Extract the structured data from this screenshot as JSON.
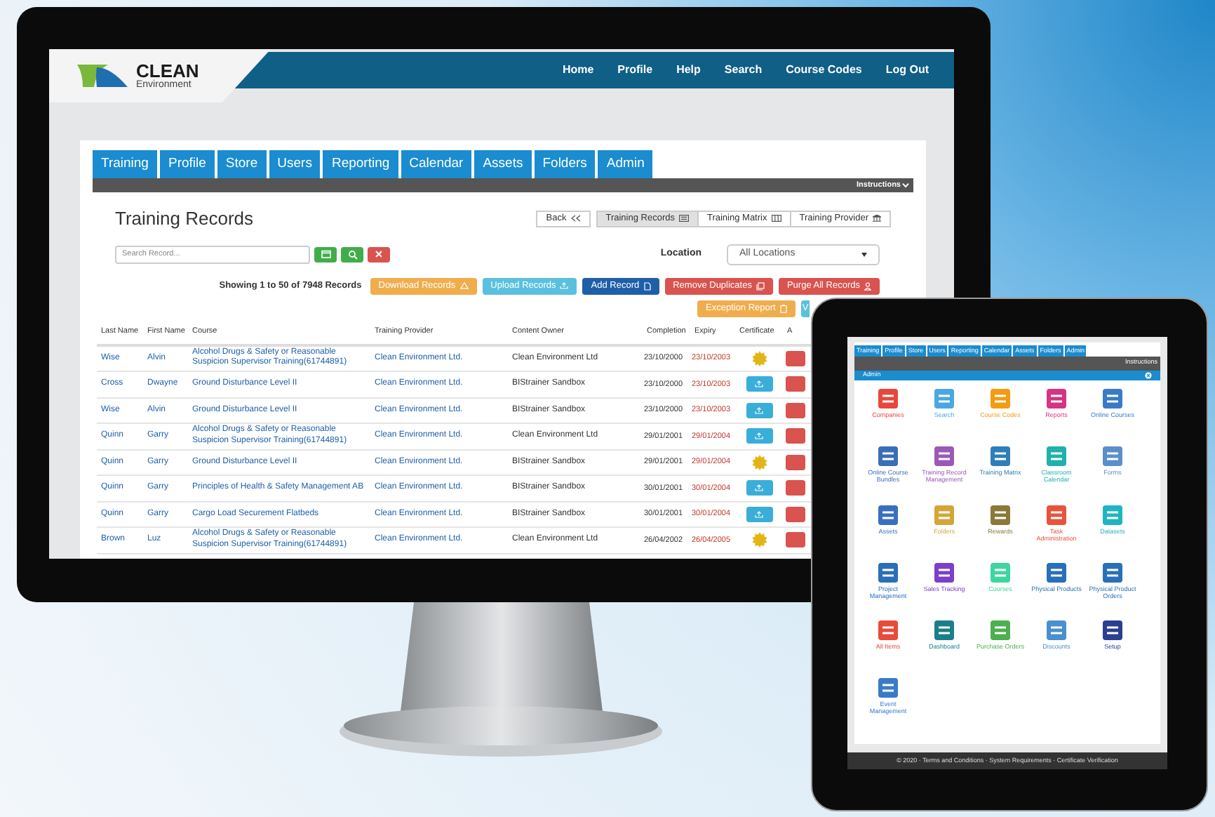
{
  "header": {
    "logo": {
      "title": "CLEAN",
      "subtitle": "Environment"
    },
    "nav": [
      "Home",
      "Profile",
      "Help",
      "Search",
      "Course Codes",
      "Log Out"
    ]
  },
  "tabs": [
    {
      "label": "Training",
      "selected": false
    },
    {
      "label": "Profile",
      "selected": false
    },
    {
      "label": "Store",
      "selected": false
    },
    {
      "label": "Users",
      "selected": false
    },
    {
      "label": "Reporting",
      "selected": false
    },
    {
      "label": "Calendar",
      "selected": false
    },
    {
      "label": "Assets",
      "selected": false
    },
    {
      "label": "Folders",
      "selected": false
    },
    {
      "label": "Admin",
      "selected": false
    }
  ],
  "instructions": "Instructions",
  "page_title": "Training Records",
  "view_buttons": [
    {
      "label": "Back",
      "selected": false
    },
    {
      "label": "Training Records",
      "selected": true
    },
    {
      "label": "Training Matrix",
      "selected": false
    },
    {
      "label": "Training Provider",
      "selected": false
    }
  ],
  "search": {
    "placeholder": "Search Record..."
  },
  "location": {
    "label": "Location",
    "value": "All Locations"
  },
  "record_count": "Showing 1 to 50 of 7948 Records",
  "actions": [
    {
      "label": "Download Records",
      "color": "#f0ad4e"
    },
    {
      "label": "Upload Records",
      "color": "#5bc0de"
    },
    {
      "label": "Add Record",
      "color": "#1f5fa8"
    },
    {
      "label": "Remove Duplicates",
      "color": "#d9534f"
    },
    {
      "label": "Purge All Records",
      "color": "#d9534f"
    },
    {
      "label": "Exception Report",
      "color": "#f0ad4e"
    },
    {
      "label": "V",
      "color": "#5bc0de"
    }
  ],
  "table": {
    "columns": [
      "Last Name",
      "First Name",
      "Course",
      "Training Provider",
      "Content Owner",
      "Completion",
      "Expiry",
      "Certificate",
      "A"
    ],
    "rows": [
      {
        "last_name": "Wise",
        "first_name": "Alvin",
        "course": "Alcohol Drugs & Safety or Reasonable Suspicion Supervisor Training(61744891)",
        "training_provider": "Clean Environment Ltd.",
        "content_owner": "Clean Environment Ltd",
        "completion": "23/10/2000",
        "expiry": "23/10/2003",
        "kind": "seal"
      },
      {
        "last_name": "Cross",
        "first_name": "Dwayne",
        "course": "Ground Disturbance Level II",
        "training_provider": "Clean Environment Ltd.",
        "content_owner": "BIStrainer Sandbox",
        "completion": "23/10/2000",
        "expiry": "23/10/2003",
        "kind": "upload"
      },
      {
        "last_name": "Wise",
        "first_name": "Alvin",
        "course": "Ground Disturbance Level II",
        "training_provider": "Clean Environment Ltd.",
        "content_owner": "BIStrainer Sandbox",
        "completion": "23/10/2000",
        "expiry": "23/10/2003",
        "kind": "upload"
      },
      {
        "last_name": "Quinn",
        "first_name": "Garry",
        "course": "Alcohol Drugs & Safety or Reasonable Suspicion Supervisor Training(61744891)",
        "training_provider": "Clean Environment Ltd.",
        "content_owner": "Clean Environment Ltd",
        "completion": "29/01/2001",
        "expiry": "29/01/2004",
        "kind": "upload"
      },
      {
        "last_name": "Quinn",
        "first_name": "Garry",
        "course": "Ground Disturbance Level II",
        "training_provider": "Clean Environment Ltd.",
        "content_owner": "BIStrainer Sandbox",
        "completion": "29/01/2001",
        "expiry": "29/01/2004",
        "kind": "seal"
      },
      {
        "last_name": "Quinn",
        "first_name": "Garry",
        "course": "Principles of Health & Safety Management AB",
        "training_provider": "Clean Environment Ltd.",
        "content_owner": "BIStrainer Sandbox",
        "completion": "30/01/2001",
        "expiry": "30/01/2004",
        "kind": "upload"
      },
      {
        "last_name": "Quinn",
        "first_name": "Garry",
        "course": "Cargo Load Securement Flatbeds",
        "training_provider": "Clean Environment Ltd.",
        "content_owner": "BIStrainer Sandbox",
        "completion": "30/01/2001",
        "expiry": "30/01/2004",
        "kind": "upload"
      },
      {
        "last_name": "Brown",
        "first_name": "Luz",
        "course": "Alcohol Drugs & Safety or Reasonable Suspicion Supervisor Training(61744891)",
        "training_provider": "Clean Environment Ltd.",
        "content_owner": "Clean Environment Ltd",
        "completion": "26/04/2002",
        "expiry": "26/04/2005",
        "kind": "seal"
      }
    ]
  },
  "tablet": {
    "tabs": [
      "Training",
      "Profile",
      "Store",
      "Users",
      "Reporting",
      "Calendar",
      "Assets",
      "Folders",
      "Admin"
    ],
    "instructions": "Instructions",
    "panel_title": "Admin",
    "apps": [
      {
        "label": "Companies",
        "color": "#e8473c"
      },
      {
        "label": "Search",
        "color": "#4aa8e0"
      },
      {
        "label": "Course Codes",
        "color": "#f39c12"
      },
      {
        "label": "Reports",
        "color": "#d63384"
      },
      {
        "label": "Online Courses",
        "color": "#3a7bc8"
      },
      {
        "label": "Online Course Bundles",
        "color": "#3a6fb5"
      },
      {
        "label": "Training Record Management",
        "color": "#9b59b6"
      },
      {
        "label": "Training Matrix",
        "color": "#2e7fb8"
      },
      {
        "label": "Classroom Calendar",
        "color": "#20b2aa"
      },
      {
        "label": "Forms",
        "color": "#5b8fc7"
      },
      {
        "label": "Assets",
        "color": "#3a6fc0"
      },
      {
        "label": "Folders",
        "color": "#d4a63a"
      },
      {
        "label": "Rewards",
        "color": "#8a7a3a"
      },
      {
        "label": "Task Administration",
        "color": "#e8533c"
      },
      {
        "label": "Datasets",
        "color": "#1fb5c0"
      },
      {
        "label": "Project Management",
        "color": "#2a6fb8"
      },
      {
        "label": "Sales Tracking",
        "color": "#7b3fc8"
      },
      {
        "label": "Courses",
        "color": "#3ed6a0"
      },
      {
        "label": "Physical Products",
        "color": "#2a6fb9"
      },
      {
        "label": "Physical Product Orders",
        "color": "#2a70b8"
      },
      {
        "label": "All Items",
        "color": "#e84a3c"
      },
      {
        "label": "Dashboard",
        "color": "#1a7f8a"
      },
      {
        "label": "Purchase Orders",
        "color": "#4caf50"
      },
      {
        "label": "Discounts",
        "color": "#4a8fd0"
      },
      {
        "label": "Setup",
        "color": "#2c3e90"
      },
      {
        "label": "Event Management",
        "color": "#3a7bc9"
      }
    ],
    "footer": "© 2020 · Terms and Conditions · System Requirements · Certificate Verification"
  }
}
